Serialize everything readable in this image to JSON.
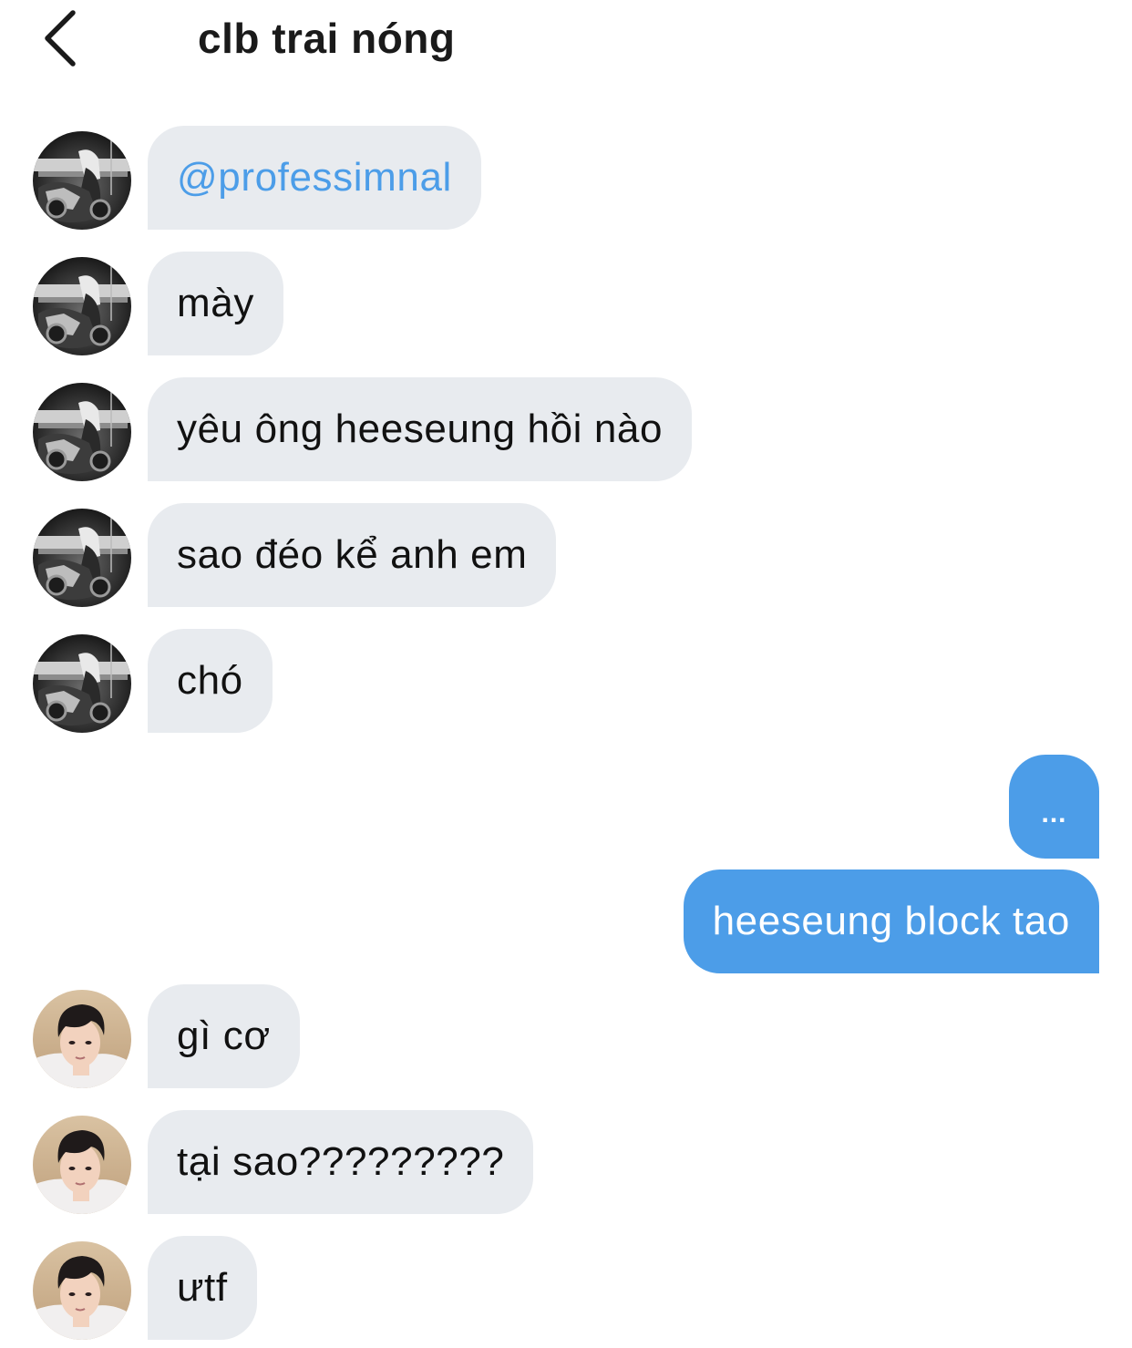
{
  "header": {
    "back_icon": "chevron-left-icon",
    "title": "clb trai nóng"
  },
  "colors": {
    "incoming_bubble": "#e8ebef",
    "outgoing_bubble": "#4c9de8",
    "mention_text": "#4c9de8"
  },
  "messages": [
    {
      "direction": "incoming",
      "sender_avatar": "avatar-1",
      "text": "@professimnal"
    },
    {
      "direction": "incoming",
      "sender_avatar": "avatar-1",
      "text": "mày"
    },
    {
      "direction": "incoming",
      "sender_avatar": "avatar-1",
      "text": "yêu ông heeseung hồi nào"
    },
    {
      "direction": "incoming",
      "sender_avatar": "avatar-1",
      "text": "sao đéo kể anh em"
    },
    {
      "direction": "incoming",
      "sender_avatar": "avatar-1",
      "text": "chó"
    },
    {
      "direction": "outgoing",
      "text": "..."
    },
    {
      "direction": "outgoing",
      "text": "heeseung block tao"
    },
    {
      "direction": "incoming",
      "sender_avatar": "avatar-2",
      "text": "gì cơ"
    },
    {
      "direction": "incoming",
      "sender_avatar": "avatar-2",
      "text": "tại sao?????????"
    },
    {
      "direction": "incoming",
      "sender_avatar": "avatar-2",
      "text": "ưtf"
    }
  ]
}
